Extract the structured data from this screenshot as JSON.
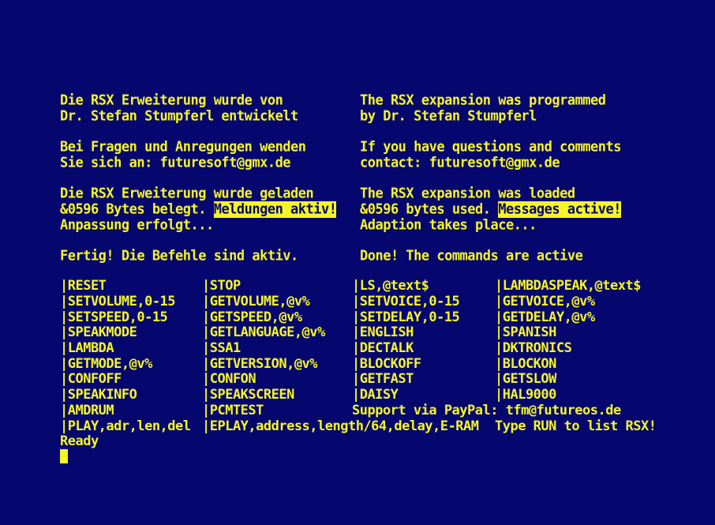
{
  "german": {
    "l1": "Die RSX Erweiterung wurde von",
    "l2": "Dr. Stefan Stumpferl entwickelt",
    "l3": "Bei Fragen und Anregungen wenden",
    "l4": "Sie sich an: futuresoft@gmx.de",
    "l5": "Die RSX Erweiterung wurde geladen",
    "l6_prefix": "&0596 Bytes belegt. ",
    "l6_highlight": "Meldungen aktiv!",
    "l7": "Anpassung erfolgt...",
    "l8": "Fertig! Die Befehle sind aktiv."
  },
  "english": {
    "l1": "The RSX expansion was programmed",
    "l2": "by Dr. Stefan Stumpferl",
    "l3": "If you have questions and comments",
    "l4": "contact: futuresoft@gmx.de",
    "l5": "The RSX expansion was loaded",
    "l6_prefix": "&0596 bytes used. ",
    "l6_highlight": "Messages active!",
    "l7": "Adaption takes place...",
    "l8": "Done! The commands are active"
  },
  "commands": {
    "r0": [
      "|RESET",
      "|STOP",
      "|LS,@text$",
      "|LAMBDASPEAK,@text$"
    ],
    "r1": [
      "|SETVOLUME,0-15",
      "|GETVOLUME,@v%",
      "|SETVOICE,0-15",
      "|GETVOICE,@v%"
    ],
    "r2": [
      "|SETSPEED,0-15",
      "|GETSPEED,@v%",
      "|SETDELAY,0-15",
      "|GETDELAY,@v%"
    ],
    "r3": [
      "|SPEAKMODE",
      "|GETLANGUAGE,@v%",
      "|ENGLISH",
      "|SPANISH"
    ],
    "r4": [
      "|LAMBDA",
      "|SSA1",
      "|DECTALK",
      "|DKTRONICS"
    ],
    "r5": [
      "|GETMODE,@v%",
      "|GETVERSION,@v%",
      "|BLOCKOFF",
      "|BLOCKON"
    ],
    "r6": [
      "|CONFOFF",
      "|CONFON",
      "|GETFAST",
      "|GETSLOW"
    ],
    "r7": [
      "|SPEAKINFO",
      "|SPEAKSCREEN",
      "|DAISY",
      "|HAL9000"
    ],
    "r8": [
      "|AMDRUM",
      "|PCMTEST",
      "Support via PayPal: tfm@futureos.de"
    ],
    "r9": [
      "|PLAY,adr,len,del",
      "|EPLAY,address,length/64,delay,E-RAM",
      "Type RUN to list RSX!"
    ]
  },
  "prompt": "Ready",
  "colors": {
    "background": "#06076e",
    "text": "#f5f52a"
  }
}
